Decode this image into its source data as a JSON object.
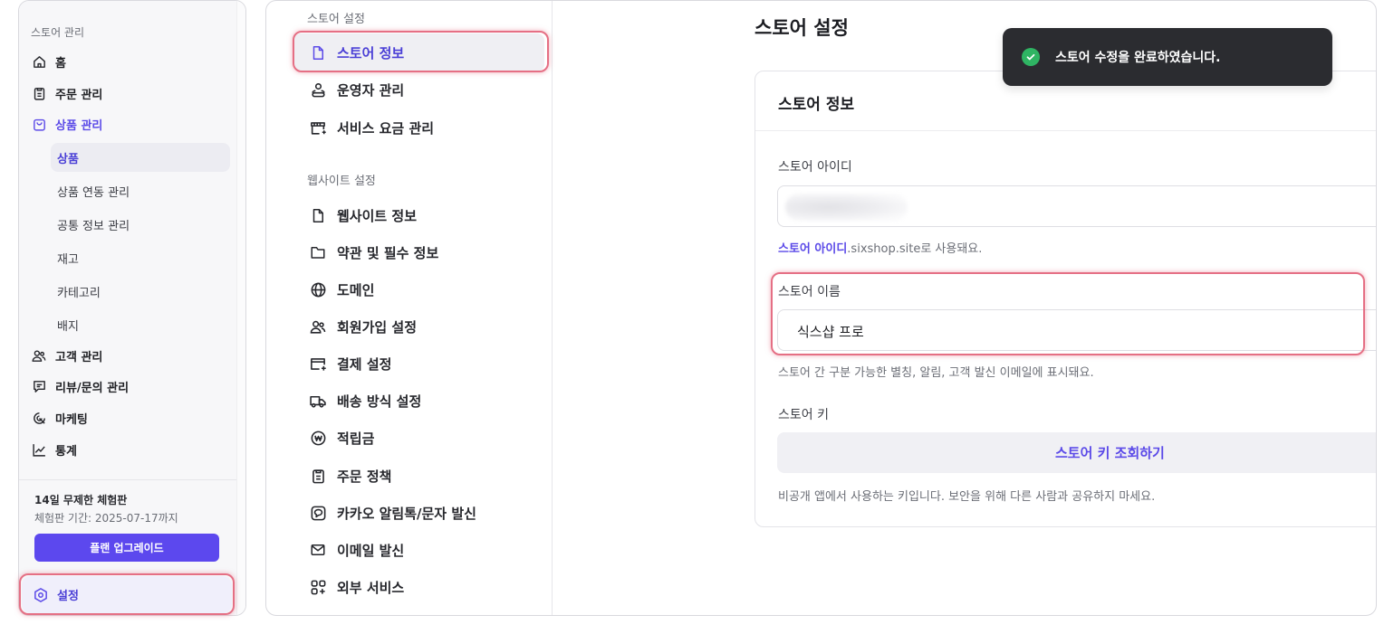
{
  "sidebar": {
    "section_label": "스토어 관리",
    "items": [
      {
        "label": "홈",
        "icon": "home-icon"
      },
      {
        "label": "주문 관리",
        "icon": "clipboard-icon"
      },
      {
        "label": "상품 관리",
        "icon": "shopping-bag-icon"
      },
      {
        "label": "고객 관리",
        "icon": "users-icon"
      },
      {
        "label": "리뷰/문의 관리",
        "icon": "message-icon"
      },
      {
        "label": "마케팅",
        "icon": "target-icon"
      },
      {
        "label": "통계",
        "icon": "chart-line-icon"
      }
    ],
    "sub_items": [
      "상품",
      "상품 연동 관리",
      "공통 정보 관리",
      "재고",
      "카테고리",
      "배지"
    ],
    "trial_title": "14일 무제한 체험판",
    "trial_period": "체험판 기간: 2025-07-17까지",
    "upgrade_label": "플랜 업그레이드",
    "settings_label": "설정"
  },
  "settings_menu": {
    "store_section": "스토어 설정",
    "store_items": [
      {
        "label": "스토어 정보",
        "icon": "file-icon"
      },
      {
        "label": "운영자 관리",
        "icon": "operator-icon"
      },
      {
        "label": "서비스 요금 관리",
        "icon": "billing-icon"
      }
    ],
    "website_section": "웹사이트 설정",
    "website_items": [
      {
        "label": "웹사이트 정보",
        "icon": "file-icon"
      },
      {
        "label": "약관 및 필수 정보",
        "icon": "folder-icon"
      },
      {
        "label": "도메인",
        "icon": "globe-icon"
      },
      {
        "label": "회원가입 설정",
        "icon": "users-icon"
      },
      {
        "label": "결제 설정",
        "icon": "payment-icon"
      },
      {
        "label": "배송 방식 설정",
        "icon": "truck-icon"
      },
      {
        "label": "적립금",
        "icon": "won-coin-icon"
      },
      {
        "label": "주문 정책",
        "icon": "clipboard-icon"
      },
      {
        "label": "카카오 알림톡/문자 발신",
        "icon": "chat-icon"
      },
      {
        "label": "이메일 발신",
        "icon": "mail-icon"
      },
      {
        "label": "외부 서비스",
        "icon": "apps-icon"
      }
    ]
  },
  "content": {
    "page_title": "스토어 설정",
    "card_title": "스토어 정보",
    "store_id_label": "스토어 아이디",
    "store_id_hint_accent": "스토어 아이디",
    "store_id_hint_rest": ".sixshop.site로 사용돼요.",
    "store_name_label": "스토어 이름",
    "store_name_value": "식스샵 프로",
    "store_name_hint": "스토어 간 구분 가능한 별칭, 알림, 고객 발신 이메일에 표시돼요.",
    "store_key_label": "스토어 키",
    "store_key_button": "스토어 키 조회하기",
    "store_key_hint": "비공개 앱에서 사용하는 키입니다. 보안을 위해 다른 사람과 공유하지 마세요."
  },
  "toast": {
    "message": "스토어 수정을 완료하였습니다."
  },
  "colors": {
    "accent": "#5b4ae8",
    "highlight": "#e56f84",
    "toast_bg": "#2b2c30",
    "success": "#2fb463"
  }
}
